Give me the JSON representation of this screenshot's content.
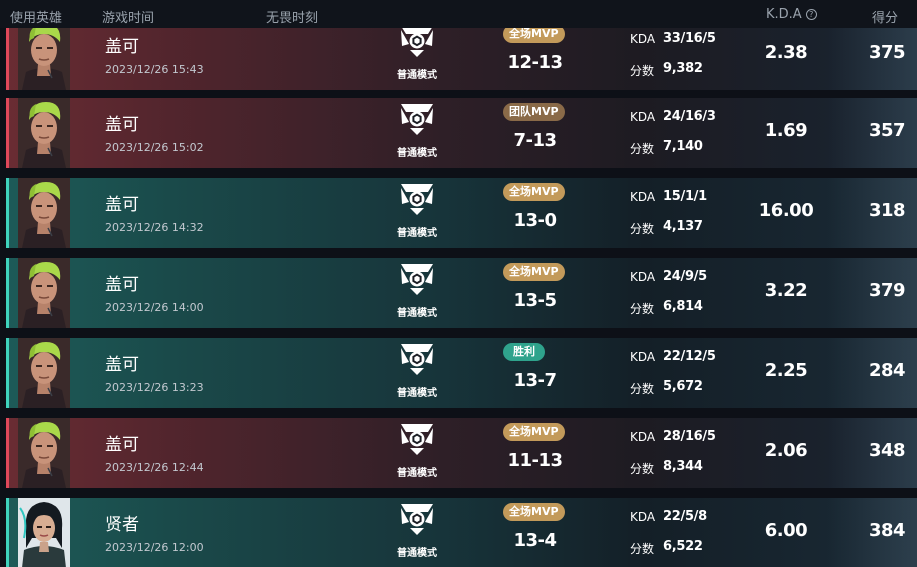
{
  "header": {
    "col_hero": "使用英雄",
    "col_time": "游戏时间",
    "col_mode": "无畏时刻",
    "col_kda": "K.D.A",
    "col_score": "得分",
    "help_icon": "question-circle-icon"
  },
  "stat_labels": {
    "kda": "KDA",
    "score": "分数"
  },
  "colors": {
    "loss_accent": "#e0485a",
    "win_accent": "#3fd3bd",
    "mvp_gold": "#c39a5a",
    "team_mvp": "#8a6a48",
    "victory": "#2fa38c"
  },
  "matches": [
    {
      "result": "loss",
      "hero": "盖可",
      "time": "2023/12/26 15:43",
      "mode": "普通模式",
      "badge": "全场MVP",
      "badge_style": "gold",
      "round_score": "12-13",
      "kda": "33/16/5",
      "score": "9,382",
      "kda_ratio": "2.38",
      "points": "375"
    },
    {
      "result": "loss",
      "hero": "盖可",
      "time": "2023/12/26 15:02",
      "mode": "普通模式",
      "badge": "团队MVP",
      "badge_style": "brown",
      "round_score": "7-13",
      "kda": "24/16/3",
      "score": "7,140",
      "kda_ratio": "1.69",
      "points": "357"
    },
    {
      "result": "win",
      "hero": "盖可",
      "time": "2023/12/26 14:32",
      "mode": "普通模式",
      "badge": "全场MVP",
      "badge_style": "gold",
      "round_score": "13-0",
      "kda": "15/1/1",
      "score": "4,137",
      "kda_ratio": "16.00",
      "points": "318"
    },
    {
      "result": "win",
      "hero": "盖可",
      "time": "2023/12/26 14:00",
      "mode": "普通模式",
      "badge": "全场MVP",
      "badge_style": "gold",
      "round_score": "13-5",
      "kda": "24/9/5",
      "score": "6,814",
      "kda_ratio": "3.22",
      "points": "379"
    },
    {
      "result": "win",
      "hero": "盖可",
      "time": "2023/12/26 13:23",
      "mode": "普通模式",
      "badge": "胜利",
      "badge_style": "teal",
      "round_score": "13-7",
      "kda": "22/12/5",
      "score": "5,672",
      "kda_ratio": "2.25",
      "points": "284"
    },
    {
      "result": "loss",
      "hero": "盖可",
      "time": "2023/12/26 12:44",
      "mode": "普通模式",
      "badge": "全场MVP",
      "badge_style": "gold",
      "round_score": "11-13",
      "kda": "28/16/5",
      "score": "8,344",
      "kda_ratio": "2.06",
      "points": "348"
    },
    {
      "result": "win",
      "hero": "贤者",
      "time": "2023/12/26 12:00",
      "mode": "普通模式",
      "badge": "全场MVP",
      "badge_style": "gold",
      "round_score": "13-4",
      "kda": "22/5/8",
      "score": "6,522",
      "kda_ratio": "6.00",
      "points": "384"
    }
  ]
}
